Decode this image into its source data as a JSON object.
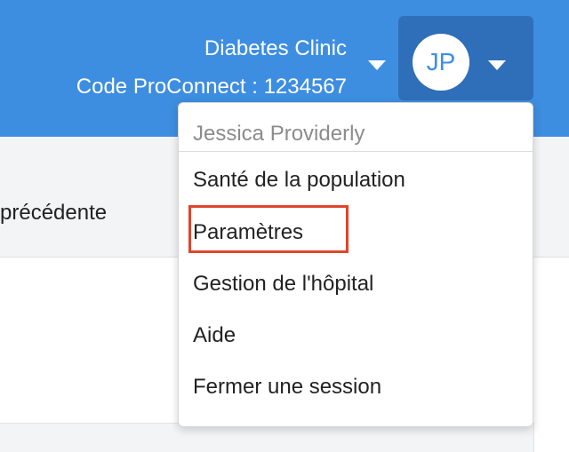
{
  "header": {
    "clinic_name": "Diabetes Clinic",
    "proconnect_code": "Code ProConnect : 1234567",
    "avatar_initials": "JP",
    "background_color": "#3d8ee0",
    "user_button_color": "#2f6fb9"
  },
  "content": {
    "previous_label": "précédente"
  },
  "user_menu": {
    "user_name": "Jessica Providerly",
    "items": [
      {
        "label": "Santé de la population"
      },
      {
        "label": "Paramètres",
        "highlighted": true
      },
      {
        "label": "Gestion de l'hôpital"
      },
      {
        "label": "Aide"
      },
      {
        "label": "Fermer une session"
      }
    ],
    "highlight_color": "#e0452b"
  }
}
